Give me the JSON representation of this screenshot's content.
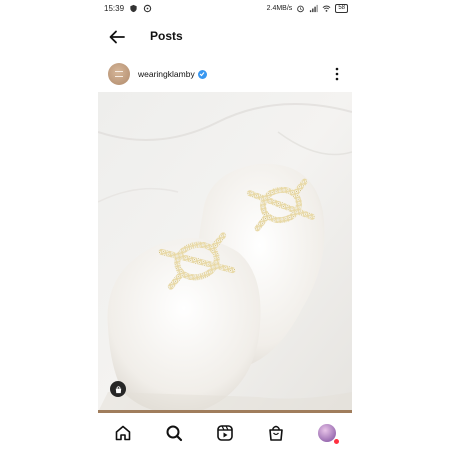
{
  "status_bar": {
    "time": "15:39",
    "network_speed": "2.4MB/s",
    "battery": "58",
    "icons": [
      "shield-icon",
      "message-icon",
      "alarm-icon",
      "signal-icon",
      "wifi-icon",
      "battery-icon"
    ]
  },
  "header": {
    "back_icon": "arrow-left-icon",
    "title": "Posts"
  },
  "post": {
    "username": "wearingklamby",
    "verified": true,
    "more_icon": "vertical-dots-icon",
    "image_alt_icon": "shopping-tag-icon"
  },
  "bottom_nav": {
    "items": [
      "home-icon",
      "search-icon",
      "reels-icon",
      "shop-icon",
      "profile-avatar"
    ]
  },
  "colors": {
    "accent_blue": "#3897f0",
    "brand_brown": "#a07d5c",
    "notification_red": "#ff3040"
  }
}
